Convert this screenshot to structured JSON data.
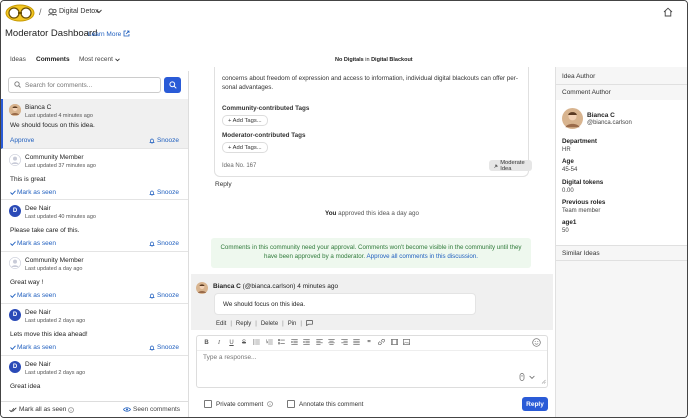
{
  "topbar": {
    "community_name": "Digital Detox",
    "slash": "/"
  },
  "header": {
    "title": "Moderator Dashboard",
    "learn_more": "Learn More"
  },
  "tabs": {
    "ideas": "Ideas",
    "comments": "Comments",
    "sort": "Most recent"
  },
  "center_title": {
    "prefix": "No Digitals",
    "middle": " in ",
    "suffix": "Digital Blackout"
  },
  "search": {
    "placeholder": "Search for comments..."
  },
  "comments": [
    {
      "name": "Bianca C",
      "time": "Last updated 4 minutes ago",
      "text": "We should focus on this idea.",
      "action": "Approve",
      "snooze": "Snooze"
    },
    {
      "name": "Community Member",
      "time": "Last updated 37 minutes ago",
      "text": "This is great",
      "action": "Mark as seen",
      "snooze": "Snooze"
    },
    {
      "name": "Dee Nair",
      "time": "Last updated 40 minutes ago",
      "text": "Please take care of this.",
      "action": "Mark as seen",
      "snooze": "Snooze"
    },
    {
      "name": "Community Member",
      "time": "Last updated a day ago",
      "text": "Great way !",
      "action": "Mark as seen",
      "snooze": "Snooze"
    },
    {
      "name": "Dee Nair",
      "time": "Last updated 2 days ago",
      "text": "Lets move this idea ahead!",
      "action": "Mark as seen",
      "snooze": "Snooze"
    },
    {
      "name": "Dee Nair",
      "time": "Last updated 2 days ago",
      "text": "Great idea",
      "action": "",
      "snooze": ""
    }
  ],
  "left_footer": {
    "mark_all": "Mark all as seen",
    "seen_comments": "Seen comments"
  },
  "idea": {
    "text_top": "concerns about freedom of expression and access to information, individual digital blackouts can offer per-",
    "text_bottom": "sonal advantages.",
    "community_tags_label": "Community-contributed Tags",
    "moderator_tags_label": "Moderator-contributed Tags",
    "add_tags": "+ Add Tags...",
    "idea_no": "Idea No. 167",
    "moderate_btn": "Moderate Idea",
    "reply": "Reply"
  },
  "approved_line": {
    "you": "You",
    "rest": " approved this idea a day ago"
  },
  "approval_notice": {
    "text": "Comments in this community need your approval. Comments won't become visible in the community until they have been approved by a moderator.",
    "link": "Approve all comments in this discussion."
  },
  "comment_block": {
    "author": "Bianca C",
    "handle": " (@bianca.carlson) 4 minutes ago",
    "text": "We should focus on this idea.",
    "actions": [
      "Edit",
      "Reply",
      "Delete",
      "Pin"
    ]
  },
  "editor": {
    "placeholder": "Type a response..."
  },
  "bottom": {
    "private": "Private comment",
    "annotate": "Annotate this comment",
    "reply_btn": "Reply"
  },
  "right_panel": {
    "idea_author": "Idea Author",
    "comment_author": "Comment Author",
    "name": "Bianca C",
    "handle": "@bianca.carlson",
    "fields": [
      {
        "label": "Department",
        "value": "HR"
      },
      {
        "label": "Age",
        "value": "45-54"
      },
      {
        "label": "Digital tokens",
        "value": "0.00"
      },
      {
        "label": "Previous roles",
        "value": "Team member"
      },
      {
        "label": "age1",
        "value": "50"
      }
    ],
    "similar_ideas": "Similar Ideas"
  },
  "colors": {
    "accent": "#2a5bd7",
    "link": "#1f5fbf",
    "notice_bg": "#eef8ee",
    "notice_text": "#2f7a3a"
  }
}
